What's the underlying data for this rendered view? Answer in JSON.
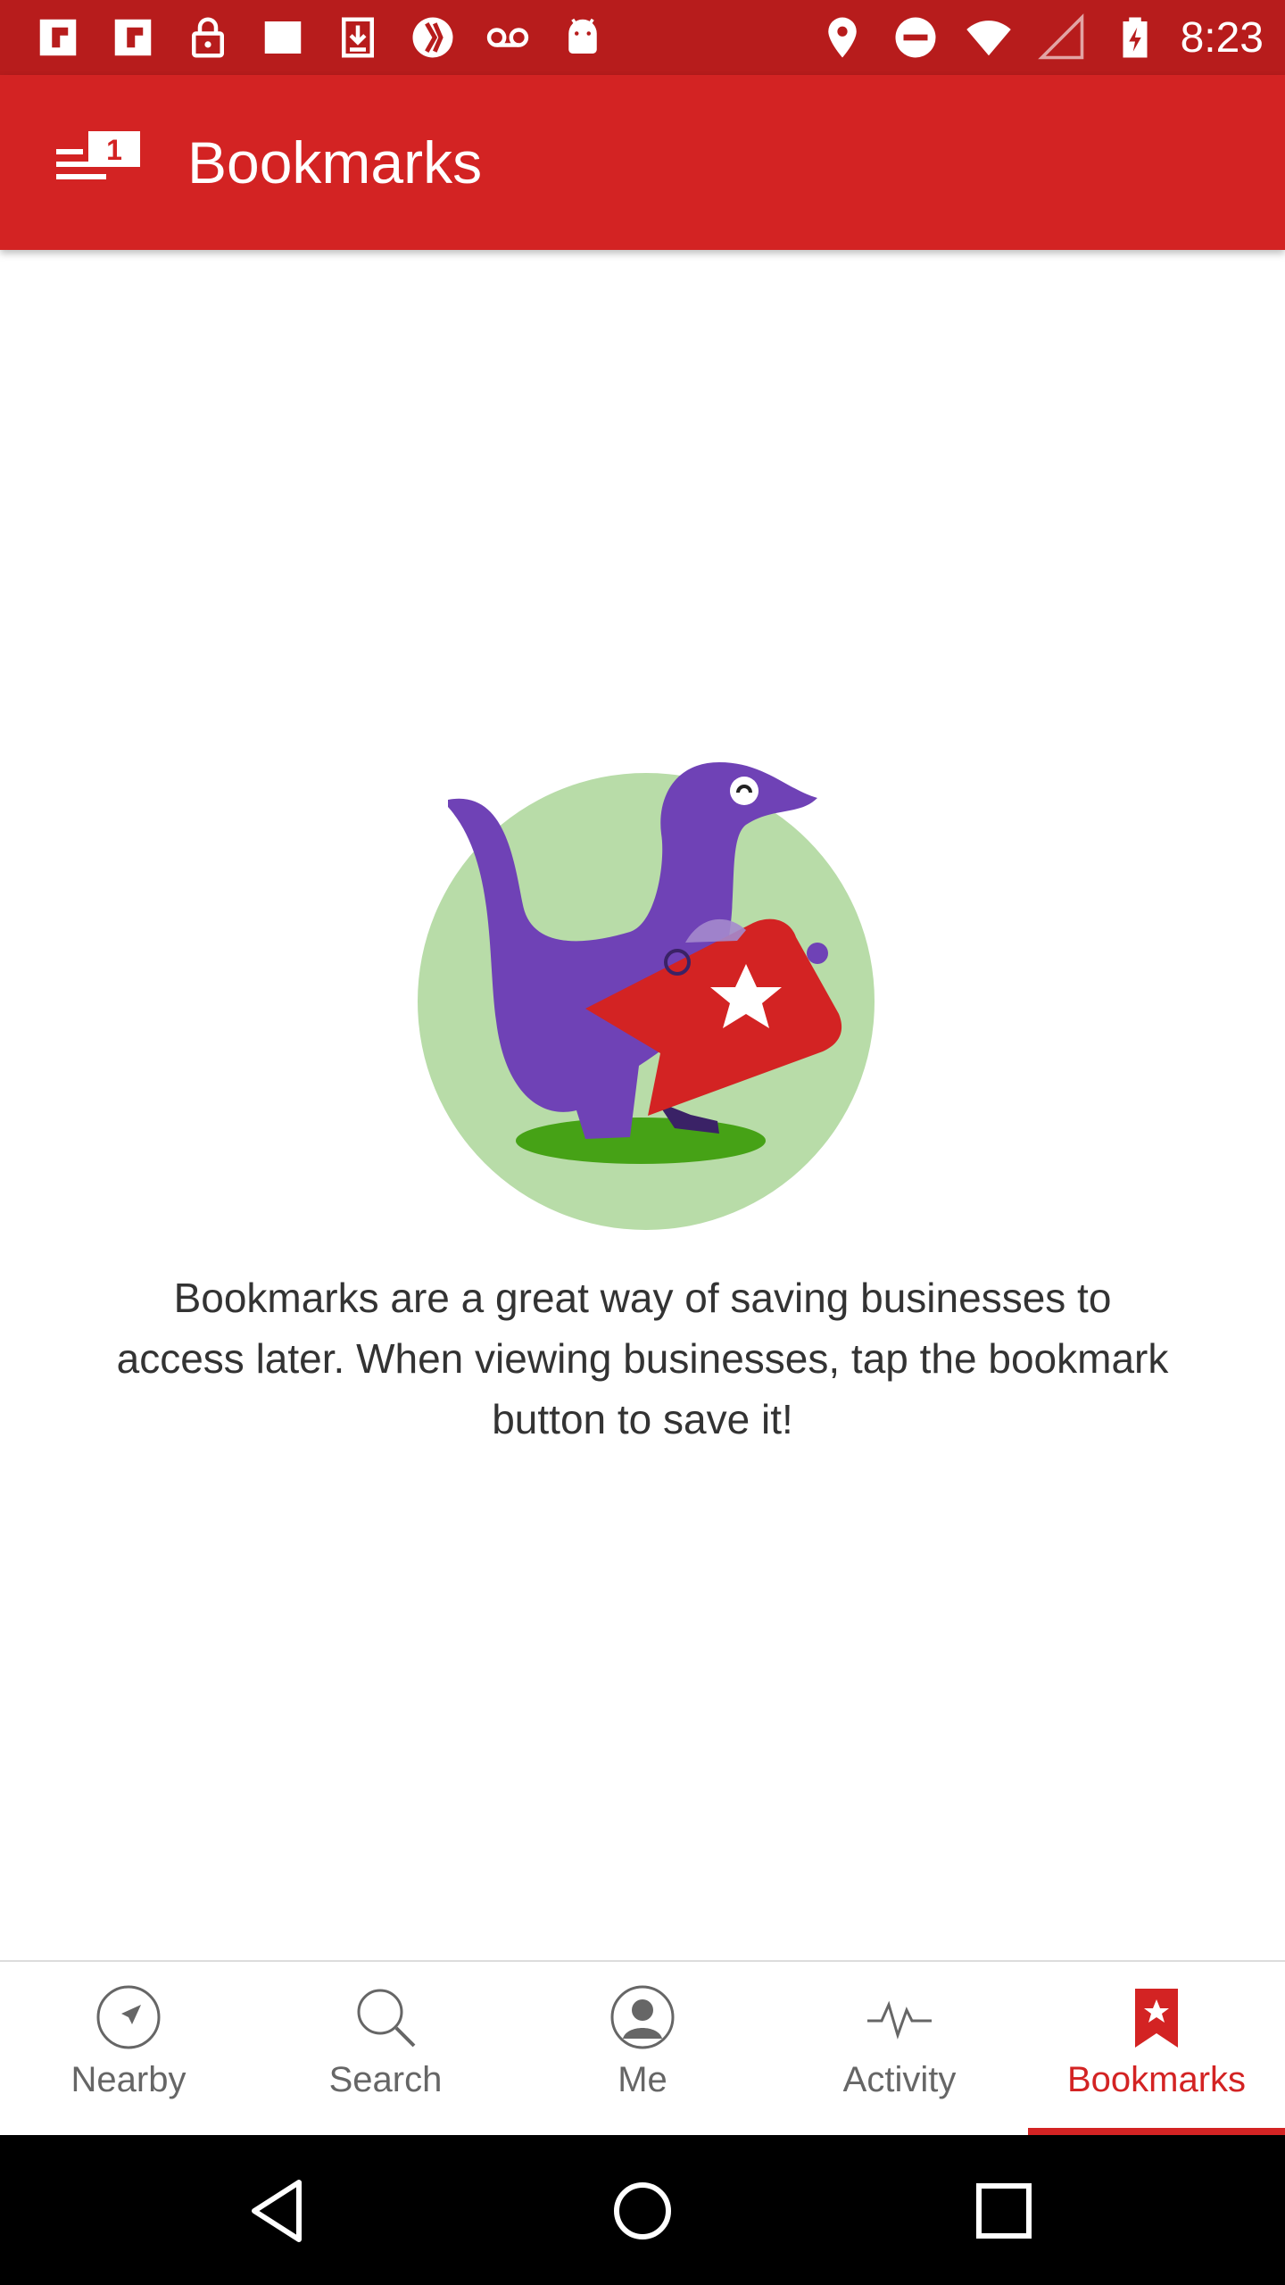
{
  "status_bar": {
    "time": "8:23",
    "left_icons": [
      "flipboard-icon",
      "flipboard-icon",
      "lock-icon",
      "square-icon",
      "download-icon",
      "app-icon",
      "voicemail-icon",
      "android-icon"
    ],
    "right_icons": [
      "location-icon",
      "do-not-disturb-icon",
      "wifi-icon",
      "signal-icon",
      "battery-charging-icon"
    ]
  },
  "app_bar": {
    "title": "Bookmarks",
    "menu_badge": "1",
    "background": "#D32323"
  },
  "empty_state": {
    "message": "Bookmarks are a great way of saving businesses to access later. When viewing businesses, tap the bookmark button to save it!"
  },
  "bottom_nav": {
    "items": [
      {
        "label": "Nearby",
        "icon": "compass-icon",
        "active": false
      },
      {
        "label": "Search",
        "icon": "search-icon",
        "active": false
      },
      {
        "label": "Me",
        "icon": "profile-icon",
        "active": false
      },
      {
        "label": "Activity",
        "icon": "activity-icon",
        "active": false
      },
      {
        "label": "Bookmarks",
        "icon": "bookmark-icon",
        "active": true
      }
    ],
    "active_color": "#D32323"
  },
  "system_nav": {
    "buttons": [
      "back-icon",
      "home-icon",
      "recents-icon"
    ]
  }
}
